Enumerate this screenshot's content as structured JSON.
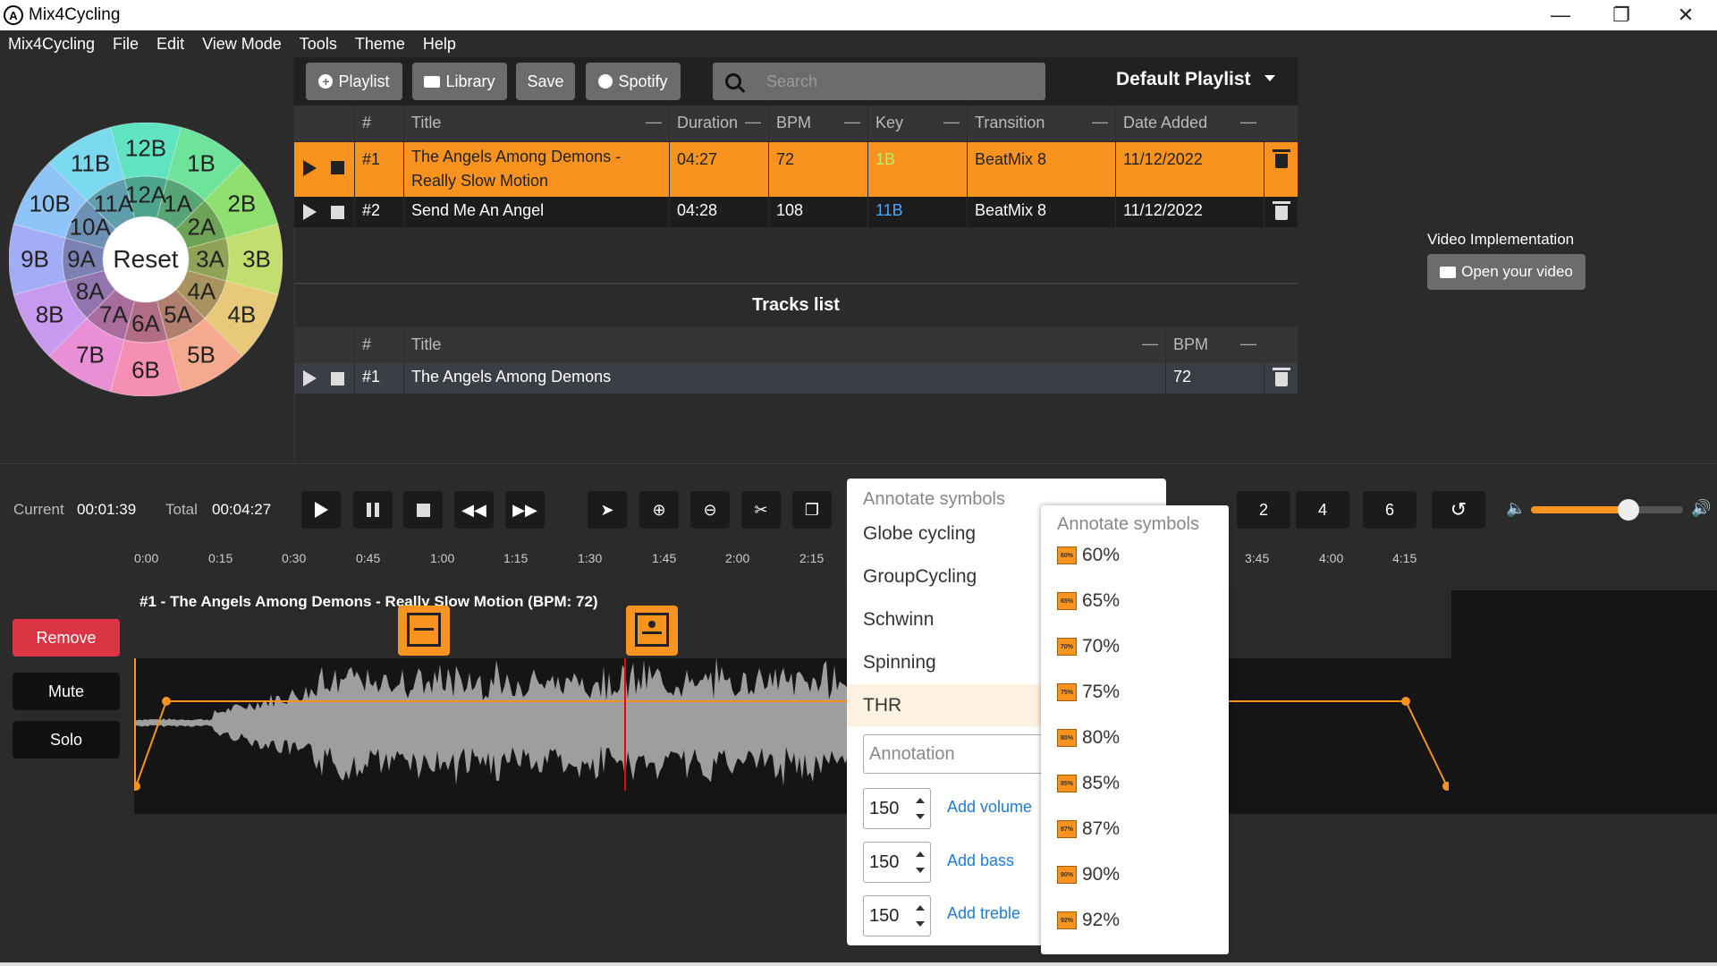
{
  "window": {
    "app_icon_text": "A",
    "title": "Mix4Cycling"
  },
  "menubar": [
    "Mix4Cycling",
    "File",
    "Edit",
    "View Mode",
    "Tools",
    "Theme",
    "Help"
  ],
  "wheel": {
    "reset_label": "Reset",
    "outer": [
      "1B",
      "2B",
      "3B",
      "4B",
      "5B",
      "6B",
      "7B",
      "8B",
      "9B",
      "10B",
      "11B",
      "12B"
    ],
    "inner": [
      "1A",
      "2A",
      "3A",
      "4A",
      "5A",
      "6A",
      "7A",
      "8A",
      "9A",
      "10A",
      "11A",
      "12A"
    ]
  },
  "toolbar": {
    "playlist": "Playlist",
    "library": "Library",
    "save": "Save",
    "spotify": "Spotify",
    "search_placeholder": "Search",
    "playlist_name": "Default Playlist"
  },
  "playlist_table": {
    "headers": [
      "#",
      "Title",
      "Duration",
      "BPM",
      "Key",
      "Transition",
      "Date Added"
    ],
    "header_dash": "—",
    "rows": [
      {
        "num": "#1",
        "title_line1": "The Angels Among Demons -",
        "title_line2": "Really Slow Motion",
        "duration": "04:27",
        "bpm": "72",
        "key": "1B",
        "transition": "BeatMix 8",
        "date": "11/12/2022"
      },
      {
        "num": "#2",
        "title_line1": "Send Me An Angel",
        "title_line2": "",
        "duration": "04:28",
        "bpm": "108",
        "key": "11B",
        "transition": "BeatMix 8",
        "date": "11/12/2022"
      }
    ]
  },
  "tracks_list": {
    "title": "Tracks list",
    "headers": [
      "#",
      "Title",
      "BPM"
    ],
    "rows": [
      {
        "num": "#1",
        "title": "The Angels Among Demons",
        "bpm": "72"
      }
    ]
  },
  "video": {
    "label": "Video Implementation",
    "button": "Open your video"
  },
  "transport": {
    "current_label": "Current",
    "current_value": "00:01:39",
    "total_label": "Total",
    "total_value": "00:04:27",
    "zoom_values": [
      "2",
      "4",
      "6"
    ],
    "volume_level": 0.64
  },
  "timeline": {
    "ticks": [
      "0:00",
      "0:15",
      "0:30",
      "0:45",
      "1:00",
      "1:15",
      "1:30",
      "1:45",
      "2:00",
      "2:15",
      "3:45",
      "4:00",
      "4:15"
    ],
    "track_title": "#1 - The Angels Among Demons - Really Slow Motion (BPM: 72)"
  },
  "side_buttons": {
    "remove": "Remove",
    "mute": "Mute",
    "solo": "Solo"
  },
  "annotate_menu": {
    "header": "Annotate symbols",
    "items": [
      "Globe cycling",
      "GroupCycling",
      "Schwinn",
      "Spinning",
      "THR"
    ],
    "annotation_placeholder": "Annotation",
    "volume_value": "150",
    "volume_link": "Add volume",
    "bass_value": "150",
    "bass_link": "Add bass",
    "treble_value": "150",
    "treble_link": "Add treble"
  },
  "thr_menu": {
    "header": "Annotate symbols",
    "items": [
      "60%",
      "65%",
      "70%",
      "75%",
      "80%",
      "85%",
      "87%",
      "90%",
      "92%"
    ]
  },
  "colors": {
    "accent": "#f7931e",
    "key_1b": "#9ee05a",
    "key_11b": "#4aa8ff",
    "remove": "#dc3545",
    "link": "#1f7bd1"
  }
}
